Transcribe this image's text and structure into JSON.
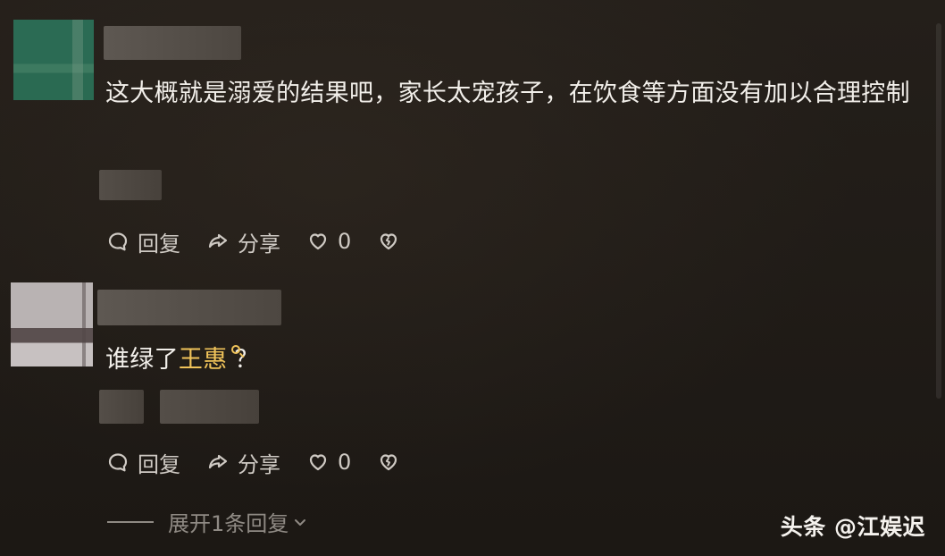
{
  "colors": {
    "background": "#1f1b17",
    "text_primary": "#f2efea",
    "text_secondary": "#cfcac4",
    "text_tertiary": "#8f8a84",
    "mention": "#f1c45a"
  },
  "comments": [
    {
      "author": "",
      "text": "这大概就是溺爱的结果吧，家长太宠孩子，在饮食等方面没有加以合理控制",
      "actions": {
        "reply_label": "回复",
        "reply_icon": "comment-bubble-icon",
        "share_label": "分享",
        "share_icon": "share-arrow-icon",
        "like_count": "0",
        "like_icon": "heart-icon",
        "dislike_icon": "broken-heart-icon"
      }
    },
    {
      "author": "",
      "text_prefix": "谁绿了",
      "mention": "王惠",
      "mention_icon": "search-icon",
      "text_suffix": "？",
      "actions": {
        "reply_label": "回复",
        "reply_icon": "comment-bubble-icon",
        "share_label": "分享",
        "share_icon": "share-arrow-icon",
        "like_count": "0",
        "like_icon": "heart-icon",
        "dislike_icon": "broken-heart-icon"
      },
      "expand_replies_label": "展开1条回复",
      "expand_icon": "chevron-down-icon"
    }
  ],
  "watermark": "头条 @江娱迟"
}
